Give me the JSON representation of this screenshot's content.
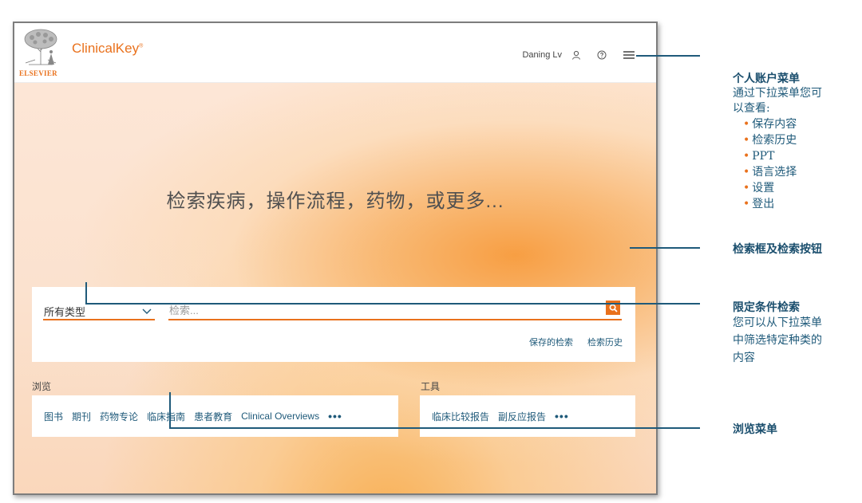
{
  "app": {
    "publisher": "ELSEVIER",
    "brand": "ClinicalKey",
    "brand_mark": "®"
  },
  "header": {
    "user_name": "Daning Lv"
  },
  "hero": {
    "title": "检索疾病，操作流程，药物，或更多..."
  },
  "search": {
    "type_value": "所有类型",
    "placeholder": "检索...",
    "links": [
      "保存的检索",
      "检索历史"
    ]
  },
  "browse": {
    "label": "浏览",
    "items": [
      "图书",
      "期刊",
      "药物专论",
      "临床指南",
      "患者教育",
      "Clinical Overviews"
    ],
    "more": "•••"
  },
  "tools": {
    "label": "工具",
    "items": [
      "临床比较报告",
      "副反应报告"
    ],
    "more": "•••"
  },
  "annotations": {
    "account": {
      "title": "个人账户菜单",
      "desc_line1": "通过下拉菜单您可",
      "desc_line2": "以查看:",
      "bullets": [
        "保存内容",
        "检索历史",
        "PPT",
        "语言选择",
        "设置",
        "登出"
      ]
    },
    "search_box": {
      "title": "检索框及检索按钮"
    },
    "filter": {
      "title": "限定条件检索",
      "desc_line1": "您可以从下拉菜单",
      "desc_line2": "中筛选特定种类的",
      "desc_line3": "内容"
    },
    "browse_menu": {
      "title": "浏览菜单"
    }
  },
  "colors": {
    "accent": "#e9711c",
    "link": "#1f5a7a",
    "annotation": "#1a4e6d"
  }
}
